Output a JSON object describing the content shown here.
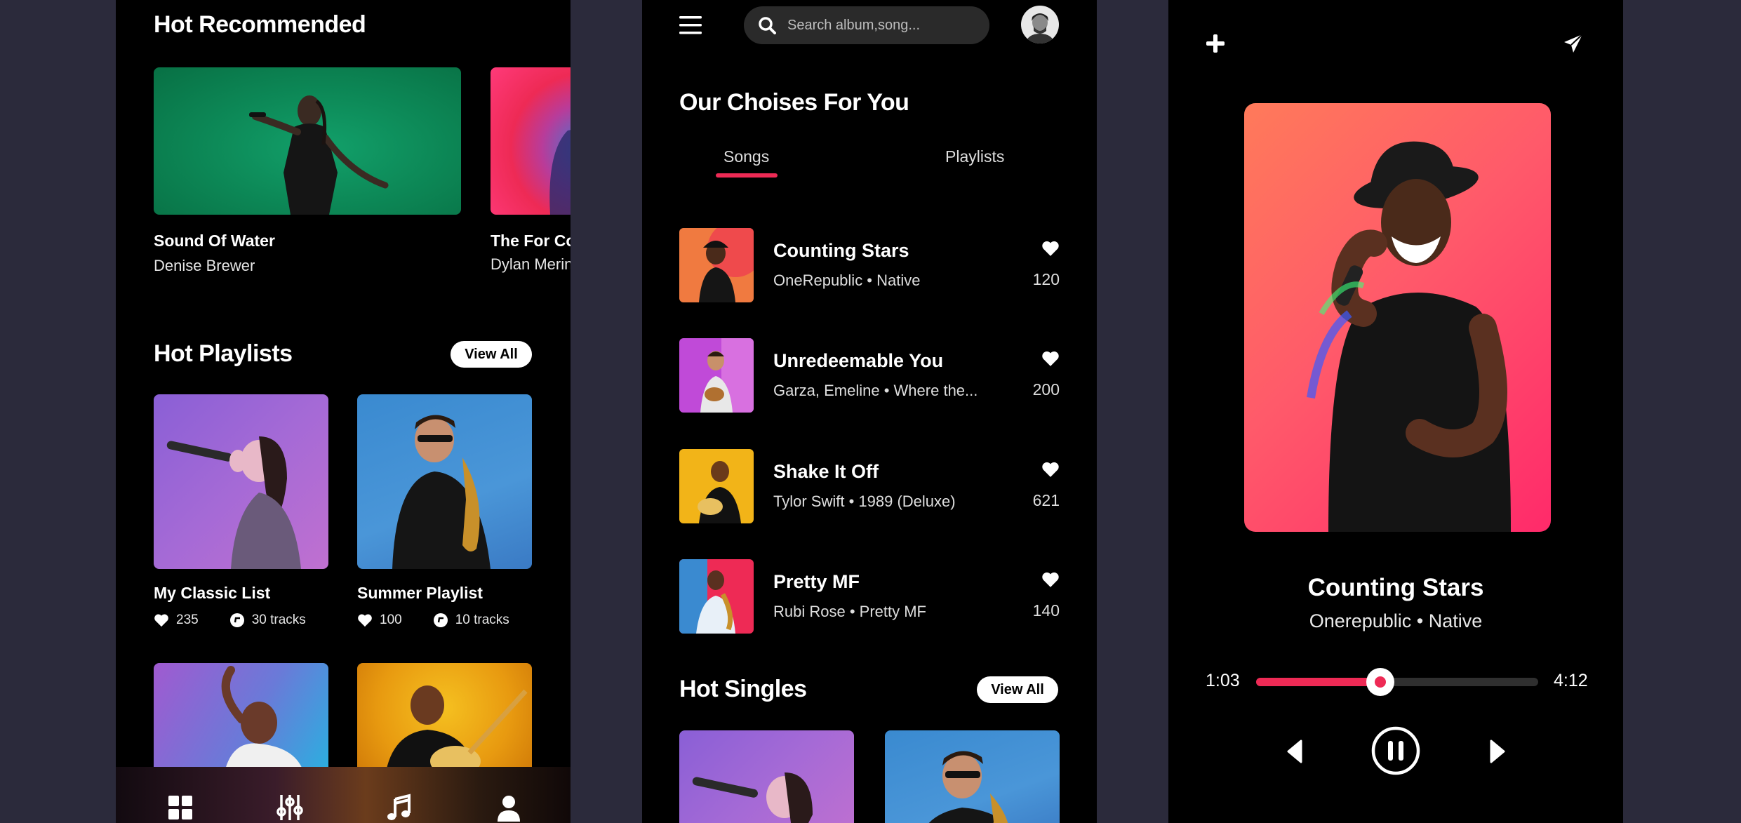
{
  "colors": {
    "accent": "#ee2a55",
    "background": "#2b2a3b",
    "panel": "#000000"
  },
  "screen1": {
    "hot_recommended_title": "Hot Recommended",
    "recommended": [
      {
        "title": "Sound Of Water",
        "artist": "Denise Brewer"
      },
      {
        "title": "The For Co",
        "artist": "Dylan Merin"
      }
    ],
    "hot_playlists_title": "Hot Playlists",
    "view_all_label": "View All",
    "playlists": [
      {
        "name": "My Classic List",
        "likes": "235",
        "tracks": "30 tracks"
      },
      {
        "name": "Summer Playlist",
        "likes": "100",
        "tracks": "10 tracks"
      }
    ],
    "nav_icons": [
      "grid-icon",
      "equalizer-icon",
      "music-note-icon",
      "user-icon"
    ]
  },
  "screen2": {
    "search_placeholder": "Search album,song...",
    "section_title": "Our Choises For You",
    "tabs": [
      {
        "label": "Songs"
      },
      {
        "label": "Playlists"
      }
    ],
    "songs": [
      {
        "title": "Counting Stars",
        "artist": "OneRepublic • Native",
        "likes": "120"
      },
      {
        "title": "Unredeemable You",
        "artist": "Garza, Emeline • Where the...",
        "likes": "200"
      },
      {
        "title": "Shake It Off",
        "artist": "Tylor Swift • 1989 (Deluxe)",
        "likes": "621"
      },
      {
        "title": "Pretty MF",
        "artist": "Rubi Rose  • Pretty MF",
        "likes": "140"
      }
    ],
    "hot_singles_title": "Hot Singles",
    "view_all_label": "View All"
  },
  "screen3": {
    "song_title": "Counting Stars",
    "song_subtitle": "Onerepublic • Native",
    "time_elapsed": "1:03",
    "time_total": "4:12",
    "progress": 0.44
  }
}
